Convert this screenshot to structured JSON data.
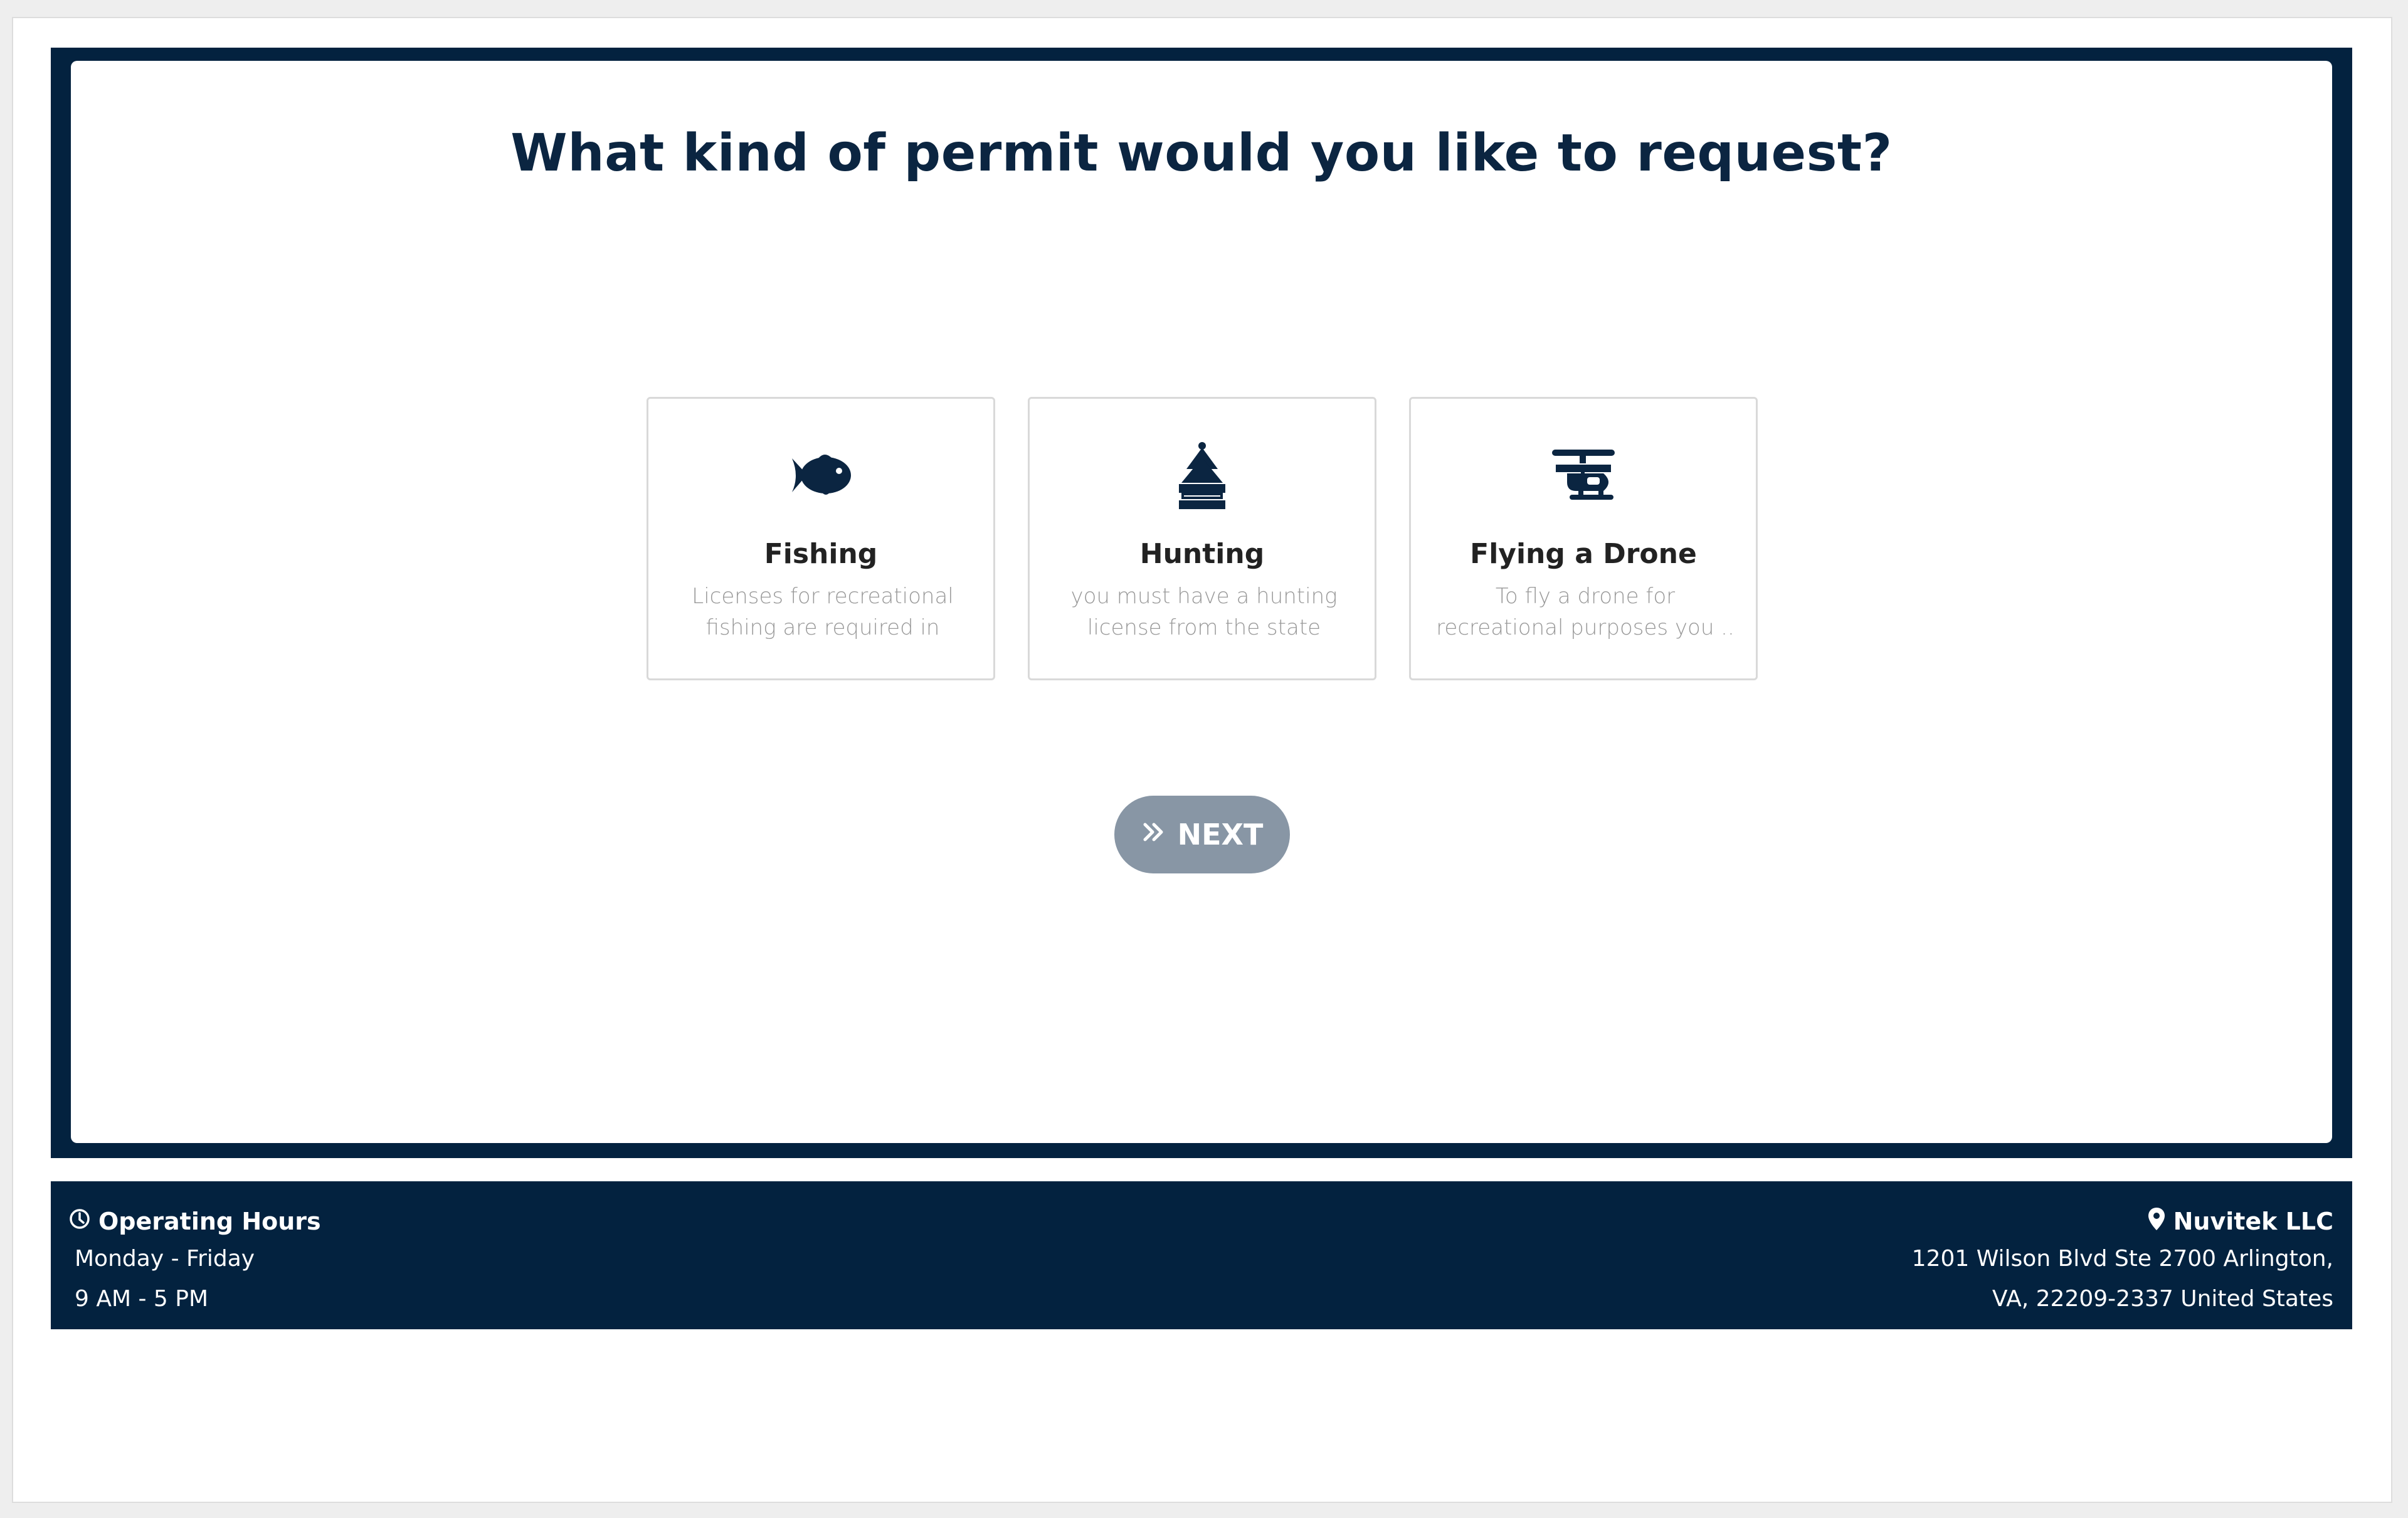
{
  "title": "What kind of permit would you like to request?",
  "cards": [
    {
      "title": "Fishing",
      "desc": "Licenses for recreational fishing are required in ever...",
      "icon": "fish-icon"
    },
    {
      "title": "Hunting",
      "desc": "you must have a hunting license from the state wher...",
      "icon": "tree-icon"
    },
    {
      "title": "Flying a Drone",
      "desc": "To fly a drone for recreational purposes you ..",
      "icon": "helicopter-icon"
    }
  ],
  "next_button": {
    "label": "NEXT",
    "icon": "double-chevron-right-icon"
  },
  "footer": {
    "hours": {
      "heading": "Operating Hours",
      "icon": "clock-icon",
      "days": "Monday - Friday",
      "time": "9 AM - 5 PM"
    },
    "company": {
      "name": "Nuvitek LLC",
      "icon": "map-pin-icon",
      "address_line1": "1201 Wilson Blvd Ste 2700 Arlington,",
      "address_line2": "VA, 22209-2337 United States"
    }
  },
  "colors": {
    "navy": "#03223f",
    "button_gray": "#8896a5",
    "card_border": "#d9d9d9",
    "desc_text": "#999999"
  }
}
